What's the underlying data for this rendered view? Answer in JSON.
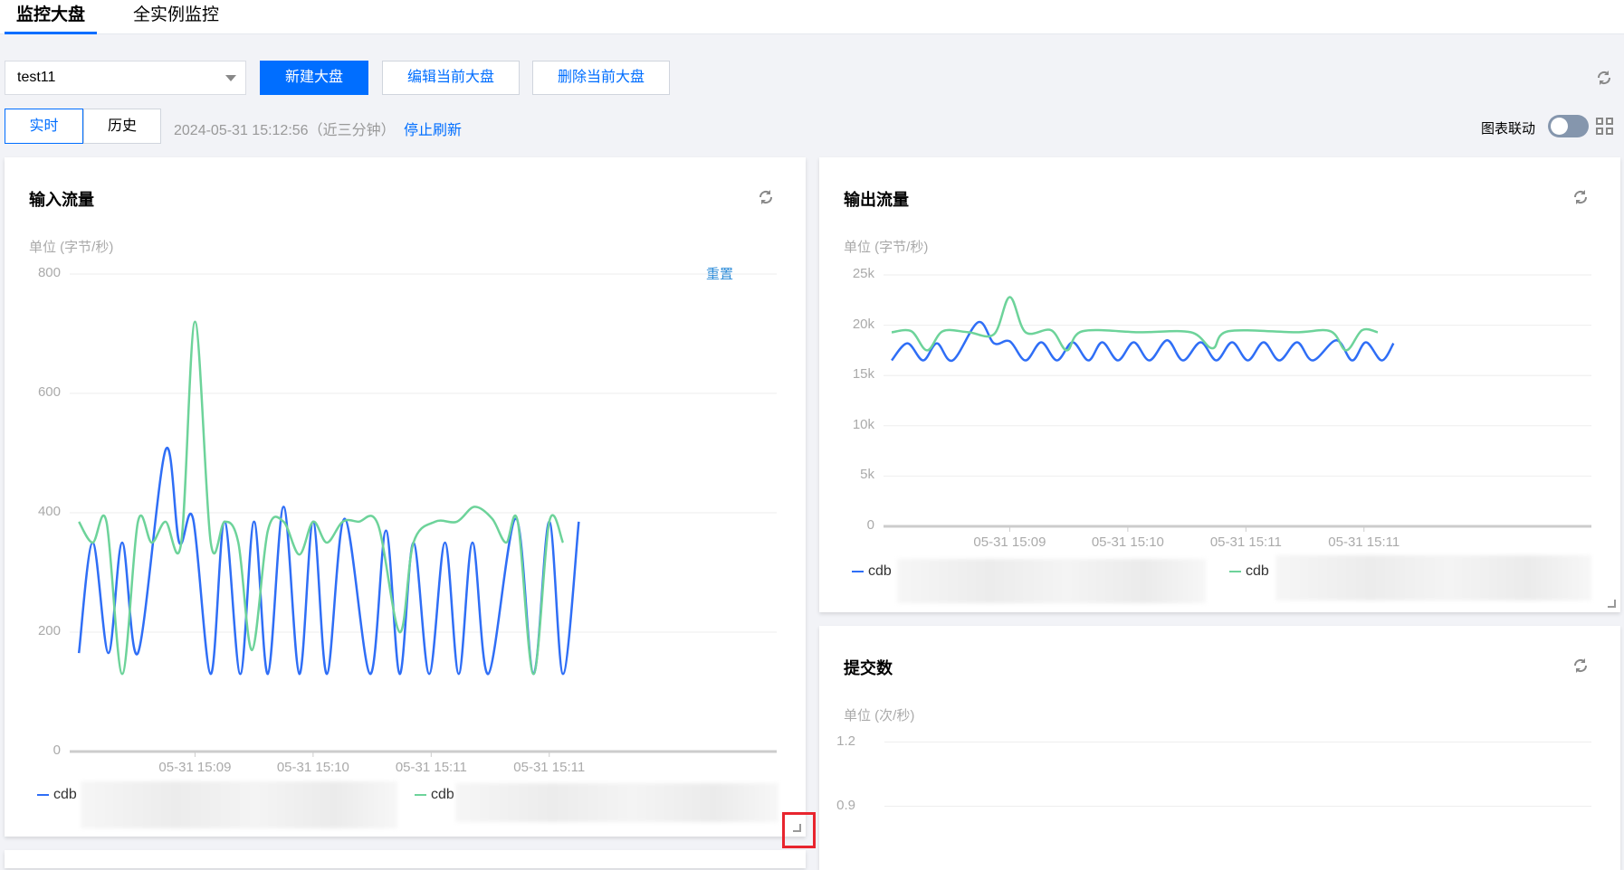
{
  "tabs": [
    {
      "label": "监控大盘",
      "active": true
    },
    {
      "label": "全实例监控",
      "active": false
    }
  ],
  "toolbar": {
    "dashboard_select": "test11",
    "new_label": "新建大盘",
    "edit_label": "编辑当前大盘",
    "delete_label": "删除当前大盘"
  },
  "time": {
    "realtime_label": "实时",
    "history_label": "历史",
    "timestamp": "2024-05-31 15:12:56（近三分钟）",
    "stop_refresh": "停止刷新",
    "link_charts_label": "图表联动",
    "link_charts_on": false
  },
  "colors": {
    "accent": "#006eff",
    "series_blue": "#2f6ef6",
    "series_green": "#6dd39a"
  },
  "charts": [
    {
      "title": "输入流量",
      "unit": "单位 (字节/秒)",
      "reset_label": "重置",
      "chart_data": {
        "type": "line",
        "ylim": [
          0,
          800
        ],
        "yticks": [
          "0",
          "200",
          "400",
          "600",
          "800"
        ],
        "yvals": [
          0,
          200,
          400,
          600,
          800
        ],
        "xticks": [
          "05-31 15:09",
          "05-31 15:10",
          "05-31 15:11",
          "05-31 15:11"
        ],
        "xtick_seconds": [
          60,
          120,
          180,
          240
        ],
        "x_unit": "seconds since 15:08:00",
        "series": [
          {
            "name": "cdb",
            "color": "#2f6ef6",
            "points": [
              [
                1,
                165
              ],
              [
                8,
                350
              ],
              [
                16,
                165
              ],
              [
                23,
                350
              ],
              [
                31,
                165
              ],
              [
                45,
                505
              ],
              [
                52,
                350
              ],
              [
                59,
                390
              ],
              [
                68,
                130
              ],
              [
                75,
                385
              ],
              [
                83,
                130
              ],
              [
                90,
                385
              ],
              [
                97,
                130
              ],
              [
                105,
                410
              ],
              [
                113,
                130
              ],
              [
                120,
                385
              ],
              [
                127,
                130
              ],
              [
                136,
                390
              ],
              [
                149,
                130
              ],
              [
                157,
                370
              ],
              [
                164,
                130
              ],
              [
                171,
                350
              ],
              [
                179,
                130
              ],
              [
                187,
                350
              ],
              [
                194,
                130
              ],
              [
                201,
                350
              ],
              [
                209,
                130
              ],
              [
                223,
                390
              ],
              [
                232,
                130
              ],
              [
                240,
                385
              ],
              [
                247,
                130
              ],
              [
                255,
                385
              ]
            ]
          },
          {
            "name": "cdb",
            "color": "#6dd39a",
            "points": [
              [
                1,
                385
              ],
              [
                8,
                350
              ],
              [
                15,
                385
              ],
              [
                23,
                130
              ],
              [
                31,
                385
              ],
              [
                38,
                350
              ],
              [
                45,
                385
              ],
              [
                53,
                350
              ],
              [
                60,
                720
              ],
              [
                68,
                350
              ],
              [
                75,
                385
              ],
              [
                82,
                350
              ],
              [
                89,
                170
              ],
              [
                97,
                370
              ],
              [
                105,
                385
              ],
              [
                113,
                330
              ],
              [
                120,
                385
              ],
              [
                127,
                350
              ],
              [
                135,
                385
              ],
              [
                143,
                385
              ],
              [
                153,
                380
              ],
              [
                164,
                200
              ],
              [
                171,
                350
              ],
              [
                182,
                385
              ],
              [
                193,
                385
              ],
              [
                202,
                410
              ],
              [
                211,
                390
              ],
              [
                218,
                350
              ],
              [
                224,
                385
              ],
              [
                232,
                130
              ],
              [
                240,
                385
              ],
              [
                247,
                350
              ]
            ]
          }
        ]
      }
    },
    {
      "title": "输出流量",
      "unit": "单位 (字节/秒)",
      "chart_data": {
        "type": "line",
        "ylim": [
          0,
          25000
        ],
        "yticks": [
          "0",
          "5k",
          "10k",
          "15k",
          "20k",
          "25k"
        ],
        "yvals": [
          0,
          5000,
          10000,
          15000,
          20000,
          25000
        ],
        "xticks": [
          "05-31 15:09",
          "05-31 15:10",
          "05-31 15:11",
          "05-31 15:11"
        ],
        "xtick_seconds": [
          60,
          120,
          180,
          240
        ],
        "x_unit": "seconds since 15:08:00",
        "series": [
          {
            "name": "cdb",
            "color": "#2f6ef6",
            "points": [
              [
                0,
                16500
              ],
              [
                8,
                18200
              ],
              [
                16,
                16500
              ],
              [
                23,
                18200
              ],
              [
                31,
                16500
              ],
              [
                44,
                20300
              ],
              [
                52,
                18200
              ],
              [
                60,
                18400
              ],
              [
                68,
                16500
              ],
              [
                76,
                18300
              ],
              [
                84,
                16500
              ],
              [
                92,
                18300
              ],
              [
                100,
                16500
              ],
              [
                107,
                18300
              ],
              [
                115,
                16500
              ],
              [
                123,
                18300
              ],
              [
                131,
                16500
              ],
              [
                140,
                18500
              ],
              [
                148,
                16500
              ],
              [
                157,
                18300
              ],
              [
                165,
                16500
              ],
              [
                173,
                18300
              ],
              [
                181,
                16500
              ],
              [
                189,
                18300
              ],
              [
                197,
                16500
              ],
              [
                206,
                18300
              ],
              [
                214,
                16500
              ],
              [
                226,
                18500
              ],
              [
                234,
                16500
              ],
              [
                241,
                18300
              ],
              [
                249,
                16500
              ],
              [
                255,
                18200
              ]
            ]
          },
          {
            "name": "cdb",
            "color": "#6dd39a",
            "points": [
              [
                0,
                19300
              ],
              [
                10,
                19400
              ],
              [
                18,
                17500
              ],
              [
                26,
                19400
              ],
              [
                39,
                19300
              ],
              [
                52,
                19100
              ],
              [
                60,
                22800
              ],
              [
                68,
                19300
              ],
              [
                81,
                19500
              ],
              [
                89,
                17500
              ],
              [
                97,
                19400
              ],
              [
                126,
                19300
              ],
              [
                152,
                19300
              ],
              [
                163,
                17700
              ],
              [
                171,
                19400
              ],
              [
                205,
                19300
              ],
              [
                223,
                19400
              ],
              [
                231,
                17500
              ],
              [
                239,
                19500
              ],
              [
                247,
                19300
              ]
            ]
          }
        ]
      }
    },
    {
      "title": "提交数",
      "unit": "单位 (次/秒)",
      "chart_data": {
        "type": "line",
        "yticks": [
          "1.2",
          "0.9"
        ],
        "yvals": [
          1.2,
          0.9
        ],
        "series": []
      }
    }
  ]
}
